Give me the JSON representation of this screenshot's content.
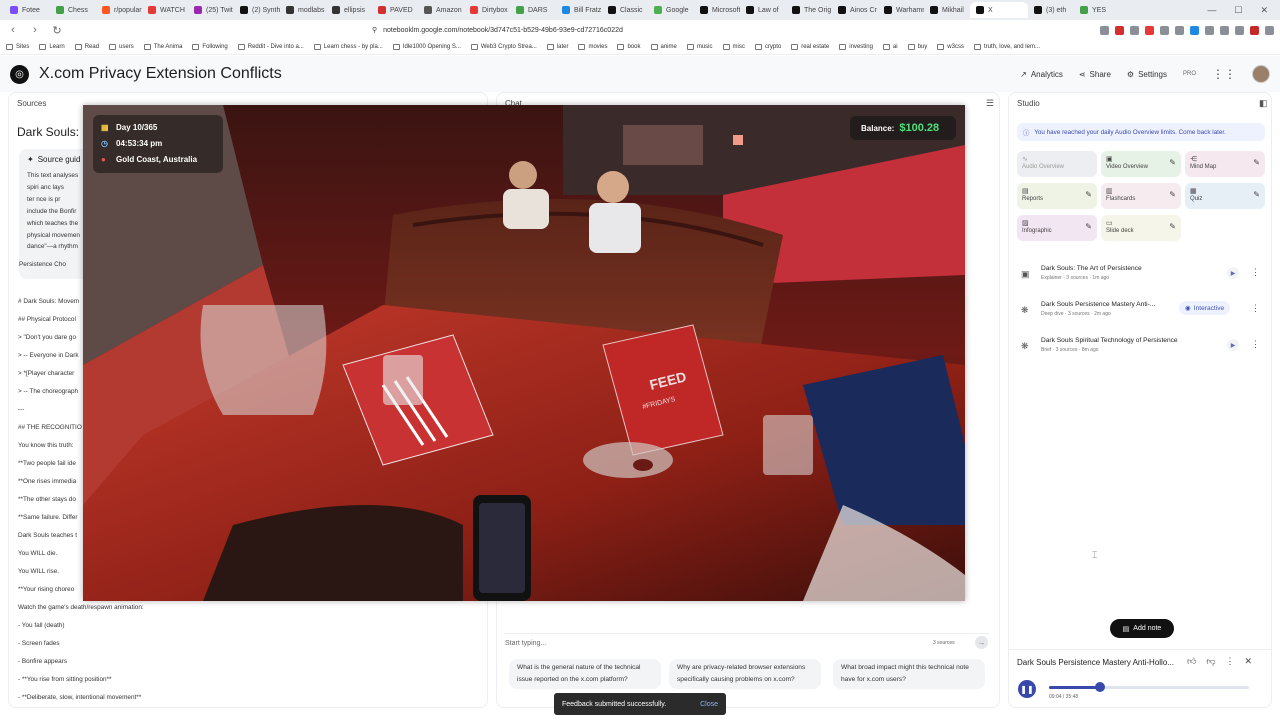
{
  "browser": {
    "tabs": [
      {
        "label": "Fotee",
        "color": "#7c4dff"
      },
      {
        "label": "Chess",
        "color": "#43a047"
      },
      {
        "label": "r/popular",
        "color": "#ff5722"
      },
      {
        "label": "WATCH",
        "color": "#e53935"
      },
      {
        "label": "(25) Twit",
        "color": "#9c27b0"
      },
      {
        "label": "(2) Synth",
        "color": "#111111"
      },
      {
        "label": "modlabs",
        "color": "#333333"
      },
      {
        "label": "ellipsis",
        "color": "#333333"
      },
      {
        "label": "PAVED",
        "color": "#d32f2f"
      },
      {
        "label": "Amazon",
        "color": "#555555"
      },
      {
        "label": "Dirtybox",
        "color": "#e53935"
      },
      {
        "label": "DARS",
        "color": "#43a047"
      },
      {
        "label": "Bill Fratz",
        "color": "#1e88e5"
      },
      {
        "label": "Classic",
        "color": "#111111"
      },
      {
        "label": "Google",
        "color": "#4caf50"
      },
      {
        "label": "Microsoft",
        "color": "#111111"
      },
      {
        "label": "Law of",
        "color": "#111111"
      },
      {
        "label": "The Orig",
        "color": "#111111"
      },
      {
        "label": "Ainos Cr",
        "color": "#111111"
      },
      {
        "label": "Warhamm",
        "color": "#111111"
      },
      {
        "label": "Mikhail",
        "color": "#111111"
      },
      {
        "label": "X",
        "color": "#111111",
        "active": true
      },
      {
        "label": "(3) eth",
        "color": "#111111"
      },
      {
        "label": "YES",
        "color": "#43a047"
      }
    ],
    "url": "notebooklm.google.com/notebook/3d747c51-b529-49b6-93e9-cd72716c022d",
    "bookmarks": [
      "Sites",
      "Learn",
      "Read",
      "users",
      "The Anima",
      "Following",
      "Reddit - Dive into a...",
      "Learn chess - by pla...",
      "Idle1000 Opening S...",
      "Web3 Crypto Strea...",
      "later",
      "movies",
      "book",
      "anime",
      "music",
      "misc",
      "crypto",
      "real estate",
      "investing",
      "ai",
      "buy",
      "w3css",
      "truth, love, and lem..."
    ]
  },
  "app": {
    "title": "X.com Privacy Extension Conflicts",
    "analytics": "Analytics",
    "share": "Share",
    "settings": "Settings",
    "pro": "PRO"
  },
  "sources": {
    "panel_title": "Sources",
    "heading": "Dark Souls: Ch",
    "guide_title": "Source guid",
    "guide_lines": [
      "This text analyses",
      "spiri  anc  lays",
      "ter  nce is pr",
      "include the Bonfir",
      "which teaches the",
      "physical movemen",
      "dance\"—a rhythm"
    ],
    "chip": "Persistence Cho",
    "lines": [
      "# Dark Souls: Movem",
      "## Physical Protocol",
      "> \"Don't you dare go",
      "> -- Everyone in Dark",
      "> *[Player character",
      "> -- The choreograph",
      "---",
      "## THE RECOGNITIO",
      "You know this truth:",
      "**Two people fail ide",
      "**One rises immedia",
      "**The other stays do",
      "**Same failure. Differ",
      "Dark Souls teaches t",
      "You WILL die.",
      "You WILL rise.",
      "**Your rising choreo",
      "Watch the game's death/respawn animation:",
      "- You fall (death)",
      "- Screen fades",
      "- Bonfire appears",
      "- **You rise from sitting position**",
      "- **Deliberate, slow, intentional movement**"
    ]
  },
  "chat": {
    "panel_title": "Chat",
    "placeholder": "Start typing...",
    "source_count": "3 sources",
    "suggestions": [
      "What is the general nature of the technical issue reported on the x.com platform?",
      "Why are privacy-related browser extensions specifically causing problems on x.com?",
      "What broad impact might this technical note have for x.com users?"
    ]
  },
  "studio": {
    "panel_title": "Studio",
    "limit_banner": "You have reached your daily Audio Overview limits. Come back later.",
    "tiles": [
      {
        "label": "Audio Overview",
        "icon": "waveform-icon",
        "color": "#eceef1",
        "text_color": "#999999"
      },
      {
        "label": "Video Overview",
        "icon": "video-icon",
        "color": "#e6f2e6",
        "text_color": "#444444"
      },
      {
        "label": "Mind Map",
        "icon": "mindmap-icon",
        "color": "#f6e8ef",
        "text_color": "#444444"
      },
      {
        "label": "Reports",
        "icon": "reports-icon",
        "color": "#eef3e6",
        "text_color": "#444444"
      },
      {
        "label": "Flashcards",
        "icon": "flashcards-icon",
        "color": "#f6ecef",
        "text_color": "#444444"
      },
      {
        "label": "Quiz",
        "icon": "quiz-icon",
        "color": "#e6eef6",
        "text_color": "#444444"
      },
      {
        "label": "Infographic",
        "icon": "infographic-icon",
        "color": "#f3e6f3",
        "text_color": "#444444"
      },
      {
        "label": "Slide deck",
        "icon": "slides-icon",
        "color": "#f5f5ea",
        "text_color": "#444444"
      }
    ],
    "outputs": [
      {
        "title": "Dark Souls: The Art of Persistence",
        "meta": "Explainer · 3 sources · 1m ago",
        "icon": "video-icon",
        "action": "play"
      },
      {
        "title": "Dark Souls Persistence Mastery Anti-...",
        "meta": "Deep dive · 3 sources · 2m ago",
        "icon": "audio-icon",
        "action": "interactive"
      },
      {
        "title": "Dark Souls Spiritual Technology of Persistence",
        "meta": "Brief · 3 sources · 8m ago",
        "icon": "audio-icon",
        "action": "play"
      }
    ],
    "interactive_label": "Interactive",
    "add_note": "Add note",
    "player": {
      "title": "Dark Souls Persistence Mastery Anti-Hollo...",
      "time": "09:04 / 35:48",
      "progress": 0.253
    }
  },
  "video": {
    "day": "Day 10/365",
    "time": "04:53:34 pm",
    "location": "Gold Coast, Australia",
    "balance_label": "Balance:",
    "balance_value": "$100.28",
    "menu_text": "FEED",
    "menu_sub": "#FRIDAYS"
  },
  "toast": {
    "message": "Feedback submitted successfully.",
    "close": "Close"
  },
  "colors": {
    "accent": "#3949ab",
    "balance_green": "#4be07a",
    "restaurant_red": "#d8322f"
  }
}
